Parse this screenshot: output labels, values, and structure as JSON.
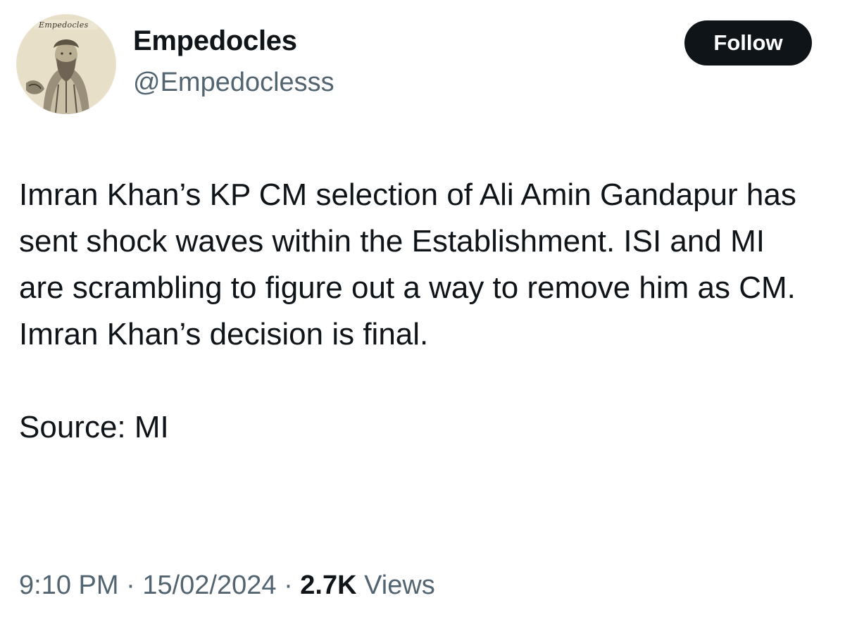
{
  "author": {
    "display_name": "Empedocles",
    "handle": "@Empedoclesss",
    "avatar_caption": "Empedocles"
  },
  "follow_button": {
    "label": "Follow"
  },
  "tweet": {
    "text": "Imran Khan’s KP CM selection of Ali Amin Gandapur has sent shock waves within the Establishment. ISI and MI are scrambling to figure out a way to remove him as CM. Imran Khan’s decision is final.",
    "source": "Source: MI"
  },
  "meta": {
    "time": "9:10 PM",
    "separator": "·",
    "date": "15/02/2024",
    "views_count": "2.7K",
    "views_label": "Views"
  },
  "colors": {
    "text_primary": "#0f1419",
    "text_secondary": "#536471",
    "button_bg": "#0f1419",
    "button_text": "#ffffff",
    "background": "#ffffff"
  }
}
